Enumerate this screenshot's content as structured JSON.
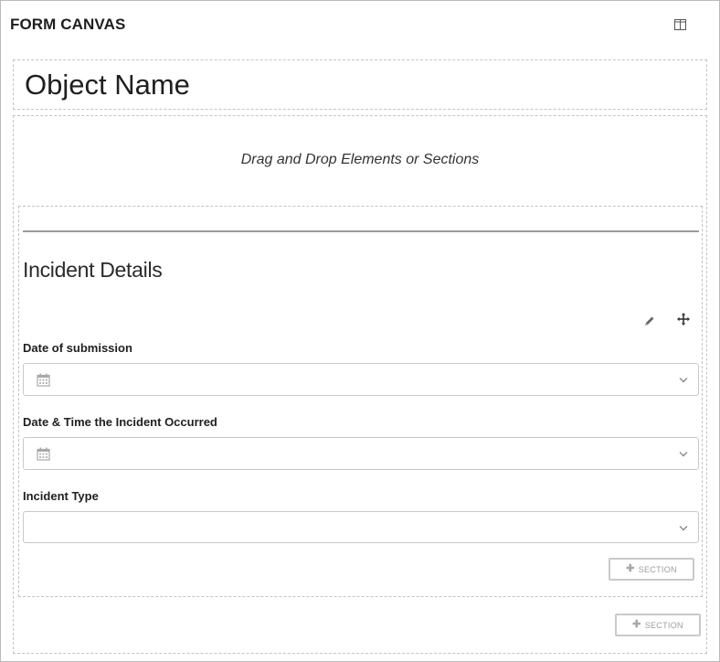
{
  "header": {
    "title": "FORM CANVAS",
    "layout_icon": "split-panel-icon"
  },
  "object": {
    "name": "Object Name"
  },
  "canvas": {
    "drop_hint": "Drag and Drop Elements or Sections"
  },
  "section": {
    "heading": "Incident Details",
    "tools": {
      "edit_icon": "pencil-icon",
      "move_icon": "move-arrows-icon"
    },
    "fields": [
      {
        "label": "Date of submission",
        "type": "date",
        "value": ""
      },
      {
        "label": "Date & Time the Incident Occurred",
        "type": "datetime",
        "value": ""
      },
      {
        "label": "Incident Type",
        "type": "select",
        "value": ""
      }
    ],
    "add_section_label": "SECTION"
  },
  "canvas_footer": {
    "add_section_label": "SECTION"
  }
}
